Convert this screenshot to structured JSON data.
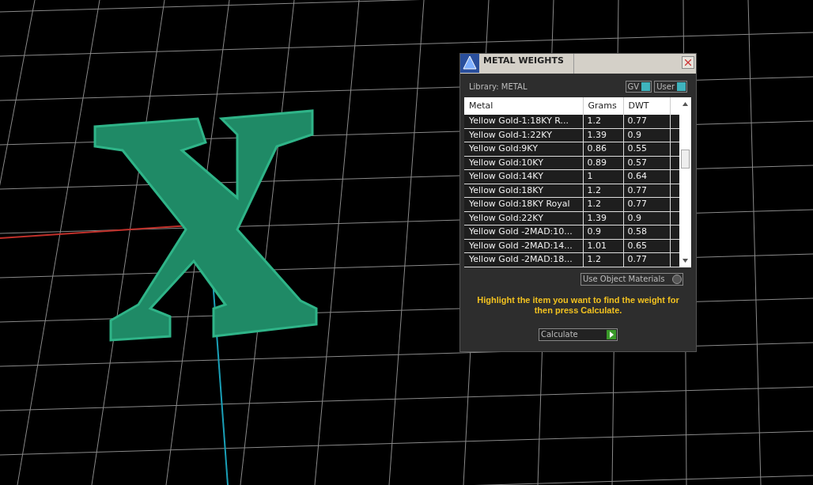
{
  "window": {
    "title": "METAL WEIGHTS"
  },
  "library": {
    "label": "Library: METAL"
  },
  "toggles": [
    {
      "label": "GV",
      "on": true
    },
    {
      "label": "User",
      "on": true
    }
  ],
  "table": {
    "columns": [
      "Metal",
      "Grams",
      "DWT"
    ],
    "rows": [
      {
        "metal": "Yellow Gold-1:18KY R...",
        "grams": "1.2",
        "dwt": "0.77"
      },
      {
        "metal": "Yellow Gold-1:22KY",
        "grams": "1.39",
        "dwt": "0.9"
      },
      {
        "metal": "Yellow Gold:9KY",
        "grams": "0.86",
        "dwt": "0.55"
      },
      {
        "metal": "Yellow Gold:10KY",
        "grams": "0.89",
        "dwt": "0.57"
      },
      {
        "metal": "Yellow Gold:14KY",
        "grams": "1",
        "dwt": "0.64"
      },
      {
        "metal": "Yellow Gold:18KY",
        "grams": "1.2",
        "dwt": "0.77"
      },
      {
        "metal": "Yellow Gold:18KY Royal",
        "grams": "1.2",
        "dwt": "0.77"
      },
      {
        "metal": "Yellow Gold:22KY",
        "grams": "1.39",
        "dwt": "0.9"
      },
      {
        "metal": "Yellow Gold -2MAD:10...",
        "grams": "0.9",
        "dwt": "0.58"
      },
      {
        "metal": "Yellow Gold -2MAD:14...",
        "grams": "1.01",
        "dwt": "0.65"
      },
      {
        "metal": "Yellow Gold -2MAD:18...",
        "grams": "1.2",
        "dwt": "0.77"
      }
    ]
  },
  "use_object_materials": {
    "label": "Use Object Materials",
    "on": false
  },
  "hint": "Highlight the item you want to find the weight for then press Calculate.",
  "calculate_button": {
    "label": "Calculate"
  }
}
